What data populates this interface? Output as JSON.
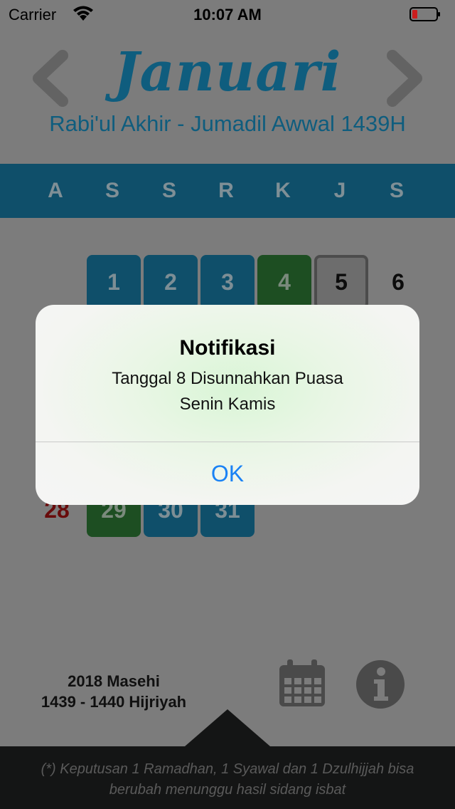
{
  "status_bar": {
    "carrier": "Carrier",
    "time": "10:07 AM"
  },
  "header": {
    "month": "Januari",
    "hijri_range": "Rabi'ul Akhir - Jumadil Awwal 1439H"
  },
  "weekdays": [
    "A",
    "S",
    "S",
    "R",
    "K",
    "J",
    "S"
  ],
  "visible_days": {
    "d1": "1",
    "d2": "2",
    "d3": "3",
    "d4": "4",
    "d5": "5",
    "d6": "6",
    "d28": "28",
    "d29": "29",
    "d30": "30",
    "d31": "31"
  },
  "footer": {
    "year_masehi": "2018 Masehi",
    "year_hijriyah": "1439 - 1440 Hijriyah",
    "note_line1": "(*) Keputusan 1 Ramadhan, 1 Syawal dan 1 Dzulhijjah bisa",
    "note_line2": "berubah menunggu hasil sidang isbat"
  },
  "alert": {
    "title": "Notifikasi",
    "message_line1": "Tanggal 8 Disunnahkan Puasa",
    "message_line2": "Senin Kamis",
    "ok_label": "OK"
  },
  "colors": {
    "brand_blue": "#1d9bd1",
    "fast_green": "#3aa247",
    "alert_button": "#1a82f5",
    "sunday_red": "#d0181e"
  }
}
